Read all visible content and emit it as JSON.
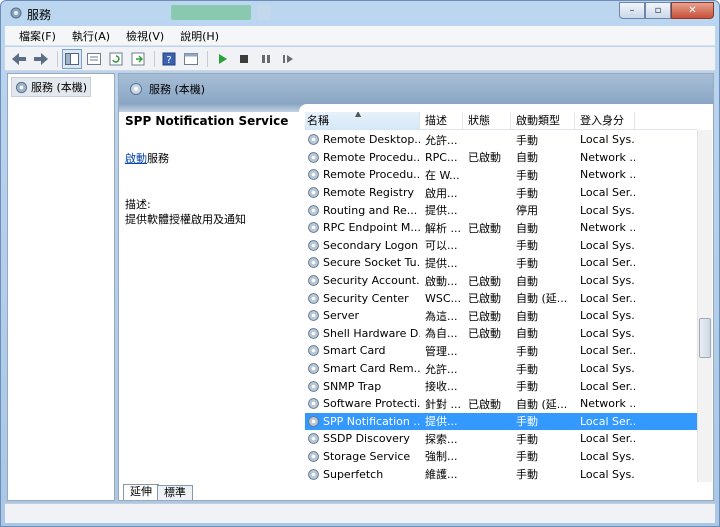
{
  "window": {
    "title": "服務",
    "buttons": {
      "minimize": "–",
      "maximize": "▫",
      "close": "✕"
    }
  },
  "menu": [
    "檔案(F)",
    "執行(A)",
    "檢視(V)",
    "說明(H)"
  ],
  "toolbar": {
    "icons": [
      "back-arrow-icon",
      "forward-arrow-icon",
      "console-tree-icon",
      "export-icon",
      "refresh-icon",
      "export-list-icon",
      "help-icon",
      "properties-icon",
      "start-icon",
      "stop-icon",
      "pause-icon",
      "resume-icon"
    ]
  },
  "tree": {
    "item_label": "服務 (本機)"
  },
  "content": {
    "header": "服務 (本機)",
    "selected_service": "SPP Notification Service",
    "start_link": "啟動",
    "start_suffix": "服務",
    "description_label": "描述:",
    "description_text": "提供軟體授權啟用及通知"
  },
  "columns": {
    "name": "名稱",
    "desc": "描述",
    "status": "狀態",
    "startup": "啟動類型",
    "logon": "登入身分"
  },
  "services": [
    {
      "name": "Remote Desktop...",
      "desc": "允許...",
      "status": "",
      "startup": "手動",
      "logon": "Local Sys..."
    },
    {
      "name": "Remote Procedu...",
      "desc": "RPC...",
      "status": "已啟動",
      "startup": "自動",
      "logon": "Network ..."
    },
    {
      "name": "Remote Procedu...",
      "desc": "在 W...",
      "status": "",
      "startup": "手動",
      "logon": "Network ..."
    },
    {
      "name": "Remote Registry",
      "desc": "啟用...",
      "status": "",
      "startup": "手動",
      "logon": "Local Ser..."
    },
    {
      "name": "Routing and Re...",
      "desc": "提供...",
      "status": "",
      "startup": "停用",
      "logon": "Local Sys..."
    },
    {
      "name": "RPC Endpoint M...",
      "desc": "解析 ...",
      "status": "已啟動",
      "startup": "自動",
      "logon": "Network ..."
    },
    {
      "name": "Secondary Logon",
      "desc": "可以...",
      "status": "",
      "startup": "手動",
      "logon": "Local Sys..."
    },
    {
      "name": "Secure Socket Tu...",
      "desc": "提供...",
      "status": "",
      "startup": "手動",
      "logon": "Local Ser..."
    },
    {
      "name": "Security Account...",
      "desc": "啟動...",
      "status": "已啟動",
      "startup": "自動",
      "logon": "Local Sys..."
    },
    {
      "name": "Security Center",
      "desc": "WSC...",
      "status": "已啟動",
      "startup": "自動 (延...",
      "logon": "Local Ser..."
    },
    {
      "name": "Server",
      "desc": "為這...",
      "status": "已啟動",
      "startup": "自動",
      "logon": "Local Sys..."
    },
    {
      "name": "Shell Hardware D...",
      "desc": "為自...",
      "status": "已啟動",
      "startup": "自動",
      "logon": "Local Sys..."
    },
    {
      "name": "Smart Card",
      "desc": "管理...",
      "status": "",
      "startup": "手動",
      "logon": "Local Ser..."
    },
    {
      "name": "Smart Card Rem...",
      "desc": "允許...",
      "status": "",
      "startup": "手動",
      "logon": "Local Sys..."
    },
    {
      "name": "SNMP Trap",
      "desc": "接收...",
      "status": "",
      "startup": "手動",
      "logon": "Local Ser..."
    },
    {
      "name": "Software Protecti...",
      "desc": "針對 ...",
      "status": "已啟動",
      "startup": "自動 (延...",
      "logon": "Network ..."
    },
    {
      "name": "SPP Notification ...",
      "desc": "提供...",
      "status": "",
      "startup": "手動",
      "logon": "Local Ser...",
      "selected": true
    },
    {
      "name": "SSDP Discovery",
      "desc": "探索...",
      "status": "",
      "startup": "手動",
      "logon": "Local Ser..."
    },
    {
      "name": "Storage Service",
      "desc": "強制...",
      "status": "",
      "startup": "手動",
      "logon": "Local Sys..."
    },
    {
      "name": "Superfetch",
      "desc": "維護...",
      "status": "",
      "startup": "手動",
      "logon": "Local Sys..."
    }
  ],
  "tabs": [
    "延伸",
    "標準"
  ],
  "colors": {
    "selection": "#3399ff",
    "header_band": "#8aa6c4"
  }
}
